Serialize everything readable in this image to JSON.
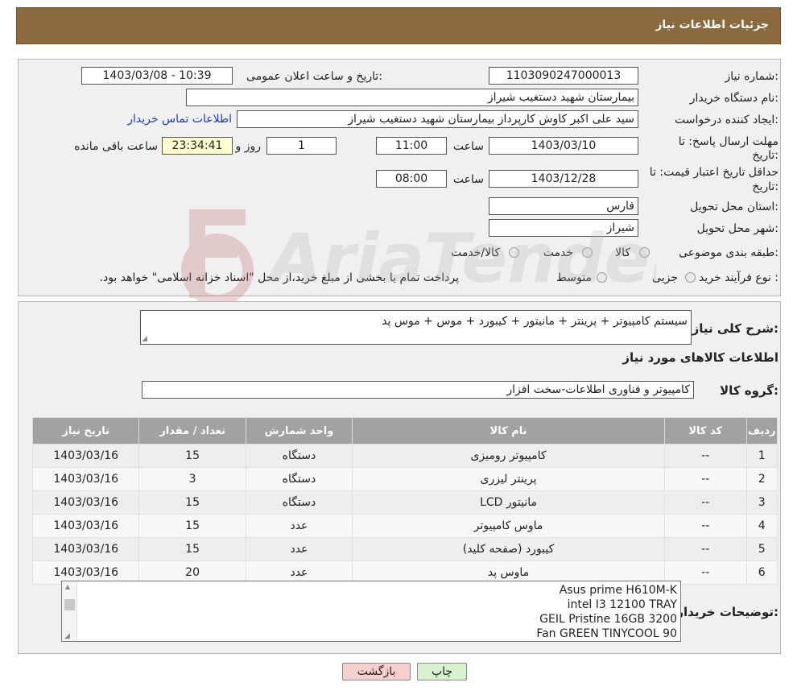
{
  "header": {
    "title": "جزئیات اطلاعات نیاز"
  },
  "form": {
    "need_number_label": "شماره نیاز:",
    "need_number": "1103090247000013",
    "announce_label": "تاریخ و ساعت اعلان عمومی:",
    "announce_value": "1403/03/08 - 10:39",
    "buyer_org_label": "نام دستگاه خریدار:",
    "buyer_org": "بیمارستان شهید دستغیب شیراز",
    "creator_label": "ایجاد کننده درخواست:",
    "creator": "سید علی اکبر کاوش کارپرداز بیمارستان شهید دستغیب شیراز",
    "contact_link": "اطلاعات تماس خریدار",
    "deadline_label_1": "مهلت ارسال پاسخ: تا",
    "deadline_label_2": "تاریخ:",
    "deadline_date": "1403/03/10",
    "time_label": "ساعت",
    "deadline_time": "11:00",
    "days_value": "1",
    "days_label": "روز و",
    "remaining_time": "23:34:41",
    "remaining_label": "ساعت باقی مانده",
    "price_validity_label_1": "حداقل تاریخ اعتبار قیمت: تا",
    "price_validity_label_2": "تاریخ:",
    "price_validity_date": "1403/12/28",
    "price_validity_time": "08:00",
    "province_label": "استان محل تحویل:",
    "province": "فارس",
    "city_label": "شهر محل تحویل:",
    "city": "شیراز",
    "category_label": "طبقه بندی موضوعی:",
    "category_options": [
      "کالا",
      "خدمت",
      "کالا/خدمت"
    ],
    "process_label": "نوع فرآیند خرید :",
    "process_options": [
      "جزیی",
      "متوسط"
    ],
    "process_note": "پرداخت تمام یا بخشی از مبلغ خرید،از محل \"اسناد خزانه اسلامی\" خواهد بود."
  },
  "summary": {
    "label": "شرح کلی نیاز:",
    "text": "سیستم کامپیوتر + پرینتر + مانیتور + کیبورد + موس + موس پد",
    "goods_info_title": "اطلاعات کالاهای مورد نیاز",
    "goods_group_label": "گروه کالا:",
    "goods_group": "کامپیوتر و فناوری اطلاعات-سخت افزار"
  },
  "table": {
    "headers": [
      "ردیف",
      "کد کالا",
      "نام کالا",
      "واحد شمارش",
      "تعداد / مقدار",
      "تاریخ نیاز"
    ],
    "rows": [
      [
        "1",
        "--",
        "کامپیوتر رومیزی",
        "دستگاه",
        "15",
        "1403/03/16"
      ],
      [
        "2",
        "--",
        "پرینتر لیزری",
        "دستگاه",
        "3",
        "1403/03/16"
      ],
      [
        "3",
        "--",
        "مانیتور LCD",
        "دستگاه",
        "15",
        "1403/03/16"
      ],
      [
        "4",
        "--",
        "ماوس کامپیوتر",
        "عدد",
        "15",
        "1403/03/16"
      ],
      [
        "5",
        "--",
        "کیبورد (صفحه کلید)",
        "عدد",
        "15",
        "1403/03/16"
      ],
      [
        "6",
        "--",
        "ماوس پد",
        "عدد",
        "20",
        "1403/03/16"
      ]
    ]
  },
  "buyer_notes": {
    "label": "توضیحات خریدار:",
    "lines": [
      "Asus prime H610M-K",
      "intel I3 12100 TRAY",
      "GEIL Pristine 16GB 3200",
      "Fan GREEN TINYCOOL 90"
    ]
  },
  "buttons": {
    "print": "چاپ",
    "back": "بازگشت"
  },
  "watermark": {
    "text": "AriaTender.neT"
  },
  "colors": {
    "header": "#8b6a3e",
    "table_header": "#a2a2a2",
    "link": "#1a3dbd",
    "remaining_bg": "#ffffd0",
    "back_button": "#f7cfcf",
    "print_button": "#d8f2d0"
  }
}
